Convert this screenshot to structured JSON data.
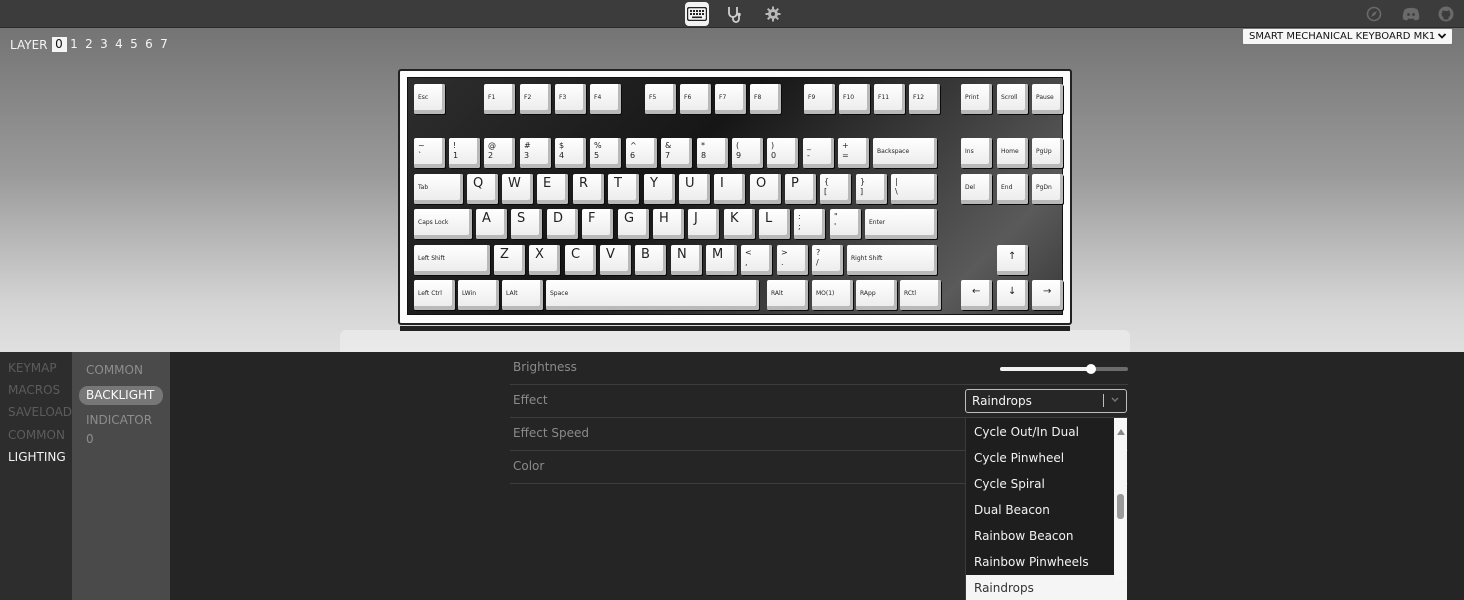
{
  "topbar": {
    "icons": [
      "keyboard-icon",
      "stethoscope-icon",
      "gear-icon",
      "compass-icon",
      "discord-icon",
      "github-icon"
    ]
  },
  "layers": {
    "label": "LAYER",
    "items": [
      "0",
      "1",
      "2",
      "3",
      "4",
      "5",
      "6",
      "7"
    ],
    "selected": "0"
  },
  "keyboard_select": {
    "value": "SMART MECHANICAL KEYBOARD MK1"
  },
  "keys": {
    "esc": "Esc",
    "f1": "F1",
    "f2": "F2",
    "f3": "F3",
    "f4": "F4",
    "f5": "F5",
    "f6": "F6",
    "f7": "F7",
    "f8": "F8",
    "f9": "F9",
    "f10": "F10",
    "f11": "F11",
    "f12": "F12",
    "print": "Print",
    "scroll": "Scroll",
    "pause": "Pause",
    "grave_top": "~",
    "grave_bot": "`",
    "n1_top": "!",
    "n1_bot": "1",
    "n2_top": "@",
    "n2_bot": "2",
    "n3_top": "#",
    "n3_bot": "3",
    "n4_top": "$",
    "n4_bot": "4",
    "n5_top": "%",
    "n5_bot": "5",
    "n6_top": "^",
    "n6_bot": "6",
    "n7_top": "&",
    "n7_bot": "7",
    "n8_top": "*",
    "n8_bot": "8",
    "n9_top": "(",
    "n9_bot": "9",
    "n0_top": ")",
    "n0_bot": "0",
    "minus_top": "_",
    "minus_bot": "-",
    "equal_top": "+",
    "equal_bot": "=",
    "backspace": "Backspace",
    "ins": "Ins",
    "home": "Home",
    "pgup": "PgUp",
    "tab": "Tab",
    "q": "Q",
    "w": "W",
    "e": "E",
    "r": "R",
    "t": "T",
    "y": "Y",
    "u": "U",
    "i": "I",
    "o": "O",
    "p": "P",
    "lbr_top": "{",
    "lbr_bot": "[",
    "rbr_top": "}",
    "rbr_bot": "]",
    "bslash_top": "|",
    "bslash_bot": "\\",
    "del": "Del",
    "end": "End",
    "pgdn": "PgDn",
    "caps": "Caps Lock",
    "a": "A",
    "s": "S",
    "d": "D",
    "f": "F",
    "g": "G",
    "h": "H",
    "j": "J",
    "k": "K",
    "l": "L",
    "semi_top": ":",
    "semi_bot": ";",
    "quote_top": "\"",
    "quote_bot": "'",
    "enter": "Enter",
    "lshift": "Left Shift",
    "z": "Z",
    "x": "X",
    "c": "C",
    "v": "V",
    "b": "B",
    "n": "N",
    "m": "M",
    "comma_top": "<",
    "comma_bot": ",",
    "period_top": ">",
    "period_bot": ".",
    "slash_top": "?",
    "slash_bot": "/",
    "rshift": "Right Shift",
    "up": "↑",
    "lctrl": "Left Ctrl",
    "lwin": "LWin",
    "lalt": "LAlt",
    "space": "Space",
    "ralt": "RAlt",
    "mo1": "MO(1)",
    "rapp": "RApp",
    "rctl": "RCtl",
    "left": "←",
    "down": "↓",
    "right": "→"
  },
  "menu": {
    "items": [
      "KEYMAP",
      "MACROS",
      "SAVELOAD",
      "COMMON",
      "LIGHTING"
    ],
    "active": "LIGHTING"
  },
  "submenu": {
    "items": [
      "COMMON",
      "BACKLIGHT",
      "INDICATOR 0"
    ],
    "active": "BACKLIGHT"
  },
  "settings": {
    "brightness_label": "Brightness",
    "brightness_level": 0.71,
    "effect_label": "Effect",
    "effect_value": "Raindrops",
    "effect_speed_label": "Effect Speed",
    "color_label": "Color"
  },
  "effect_options": {
    "visible": [
      "Cycle Out/In Dual",
      "Cycle Pinwheel",
      "Cycle Spiral",
      "Dual Beacon",
      "Rainbow Beacon",
      "Rainbow Pinwheels",
      "Raindrops"
    ],
    "selected": "Raindrops"
  }
}
